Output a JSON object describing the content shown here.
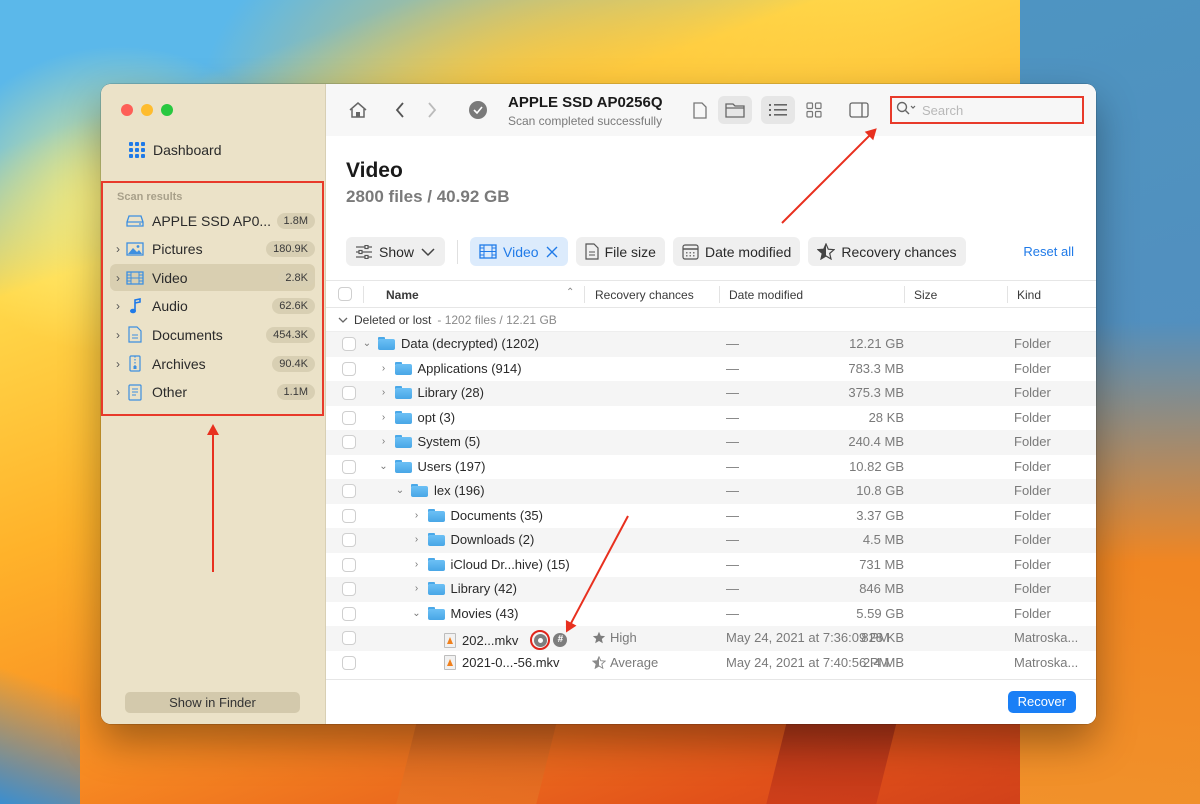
{
  "window": {
    "traffic_lights": [
      "close",
      "minimize",
      "zoom"
    ]
  },
  "sidebar": {
    "dashboard_label": "Dashboard",
    "section_title": "Scan results",
    "items": [
      {
        "label": "APPLE SSD AP0...",
        "count": "1.8M",
        "icon": "drive-icon",
        "expandable": false,
        "active": false
      },
      {
        "label": "Pictures",
        "count": "180.9K",
        "icon": "pictures-icon",
        "expandable": true,
        "active": false
      },
      {
        "label": "Video",
        "count": "2.8K",
        "icon": "video-icon",
        "expandable": true,
        "active": true
      },
      {
        "label": "Audio",
        "count": "62.6K",
        "icon": "audio-icon",
        "expandable": true,
        "active": false
      },
      {
        "label": "Documents",
        "count": "454.3K",
        "icon": "documents-icon",
        "expandable": true,
        "active": false
      },
      {
        "label": "Archives",
        "count": "90.4K",
        "icon": "archives-icon",
        "expandable": true,
        "active": false
      },
      {
        "label": "Other",
        "count": "1.1M",
        "icon": "other-icon",
        "expandable": true,
        "active": false
      }
    ],
    "show_in_finder_label": "Show in Finder"
  },
  "toolbar": {
    "drive_title": "APPLE SSD AP0256Q",
    "drive_status": "Scan completed successfully",
    "search_placeholder": "Search",
    "search_value": ""
  },
  "page": {
    "title": "Video",
    "subtitle": "2800 files / 40.92 GB"
  },
  "filters": {
    "show_label": "Show",
    "active_filter": "Video",
    "file_size_label": "File size",
    "date_modified_label": "Date modified",
    "recovery_chances_label": "Recovery chances",
    "reset_all_label": "Reset all"
  },
  "table": {
    "columns": [
      "Name",
      "Recovery chances",
      "Date modified",
      "Size",
      "Kind"
    ],
    "group": {
      "label": "Deleted or lost",
      "summary": "- 1202 files / 12.21 GB"
    },
    "rows": [
      {
        "name": "Data (decrypted) (1202)",
        "level": 0,
        "expanded": true,
        "type": "folder",
        "recovery": "",
        "date": "—",
        "size": "12.21 GB",
        "kind": "Folder"
      },
      {
        "name": "Applications (914)",
        "level": 1,
        "expanded": false,
        "type": "folder",
        "recovery": "",
        "date": "—",
        "size": "783.3 MB",
        "kind": "Folder"
      },
      {
        "name": "Library (28)",
        "level": 1,
        "expanded": false,
        "type": "folder",
        "recovery": "",
        "date": "—",
        "size": "375.3 MB",
        "kind": "Folder"
      },
      {
        "name": "opt (3)",
        "level": 1,
        "expanded": false,
        "type": "folder",
        "recovery": "",
        "date": "—",
        "size": "28 KB",
        "kind": "Folder"
      },
      {
        "name": "System (5)",
        "level": 1,
        "expanded": false,
        "type": "folder",
        "recovery": "",
        "date": "—",
        "size": "240.4 MB",
        "kind": "Folder"
      },
      {
        "name": "Users (197)",
        "level": 1,
        "expanded": true,
        "type": "folder",
        "recovery": "",
        "date": "—",
        "size": "10.82 GB",
        "kind": "Folder"
      },
      {
        "name": "lex (196)",
        "level": 2,
        "expanded": true,
        "type": "folder",
        "recovery": "",
        "date": "—",
        "size": "10.8 GB",
        "kind": "Folder"
      },
      {
        "name": "Documents (35)",
        "level": 3,
        "expanded": false,
        "type": "folder",
        "recovery": "",
        "date": "—",
        "size": "3.37 GB",
        "kind": "Folder"
      },
      {
        "name": "Downloads (2)",
        "level": 3,
        "expanded": false,
        "type": "folder",
        "recovery": "",
        "date": "—",
        "size": "4.5 MB",
        "kind": "Folder"
      },
      {
        "name": "iCloud Dr...hive) (15)",
        "level": 3,
        "expanded": false,
        "type": "folder",
        "recovery": "",
        "date": "—",
        "size": "731 MB",
        "kind": "Folder"
      },
      {
        "name": "Library (42)",
        "level": 3,
        "expanded": false,
        "type": "folder",
        "recovery": "",
        "date": "—",
        "size": "846 MB",
        "kind": "Folder"
      },
      {
        "name": "Movies (43)",
        "level": 3,
        "expanded": true,
        "type": "folder",
        "recovery": "",
        "date": "—",
        "size": "5.59 GB",
        "kind": "Folder"
      },
      {
        "name": "202...mkv",
        "level": 4,
        "expanded": null,
        "type": "file",
        "recovery": "High",
        "recovery_star": "full",
        "hover_actions": true,
        "date": "May 24, 2021 at 7:36:09 PM",
        "size": "828 KB",
        "kind": "Matroska..."
      },
      {
        "name": "2021-0...-56.mkv",
        "level": 4,
        "expanded": null,
        "type": "file",
        "recovery": "Average",
        "recovery_star": "half",
        "hover_actions": false,
        "date": "May 24, 2021 at 7:40:56 PM",
        "size": "2.4 MB",
        "kind": "Matroska..."
      }
    ]
  },
  "footer": {
    "recover_label": "Recover"
  },
  "colors": {
    "accent": "#1a7ff6",
    "annotation": "#e8301f",
    "sidebar_bg": "#ebe2c8"
  }
}
